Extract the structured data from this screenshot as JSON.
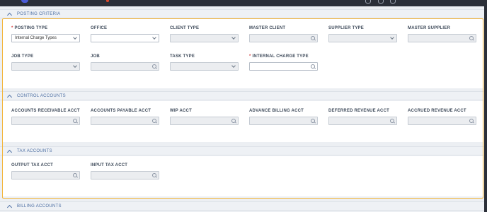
{
  "sections": {
    "posting_criteria": "POSTING CRITERIA",
    "control_accounts": "CONTROL ACCOUNTS",
    "tax_accounts": "TAX ACCOUNTS",
    "billing_accounts": "BILLING ACCOUNTS"
  },
  "posting": {
    "posting_type": {
      "label": "POSTING TYPE",
      "required": "*",
      "value": "Internal Charge Types"
    },
    "office": {
      "label": "OFFICE"
    },
    "client_type": {
      "label": "CLIENT TYPE"
    },
    "master_client": {
      "label": "MASTER CLIENT"
    },
    "supplier_type": {
      "label": "SUPPLIER TYPE"
    },
    "master_supplier": {
      "label": "MASTER SUPPLIER"
    },
    "job_type": {
      "label": "JOB TYPE"
    },
    "job": {
      "label": "JOB"
    },
    "task_type": {
      "label": "TASK TYPE"
    },
    "internal_charge_type": {
      "label": "INTERNAL CHARGE TYPE",
      "required": "*"
    }
  },
  "control": {
    "ar": {
      "label": "ACCOUNTS RECEIVABLE ACCT"
    },
    "ap": {
      "label": "ACCOUNTS PAYABLE ACCT"
    },
    "wip": {
      "label": "WIP ACCT"
    },
    "advance_billing": {
      "label": "ADVANCE BILLING ACCT"
    },
    "deferred_revenue": {
      "label": "DEFERRED REVENUE ACCT"
    },
    "accrued_revenue": {
      "label": "ACCRUED REVENUE ACCT"
    }
  },
  "tax": {
    "output": {
      "label": "OUTPUT TAX ACCT"
    },
    "input": {
      "label": "INPUT TAX ACCT"
    }
  },
  "icons": {
    "dropdown": "chevron-down-icon",
    "lookup": "search-icon",
    "collapse": "chevron-up-icon"
  },
  "colors": {
    "highlight": "#f3b53a",
    "required": "#d64545",
    "header_text": "#4d6fa3"
  }
}
